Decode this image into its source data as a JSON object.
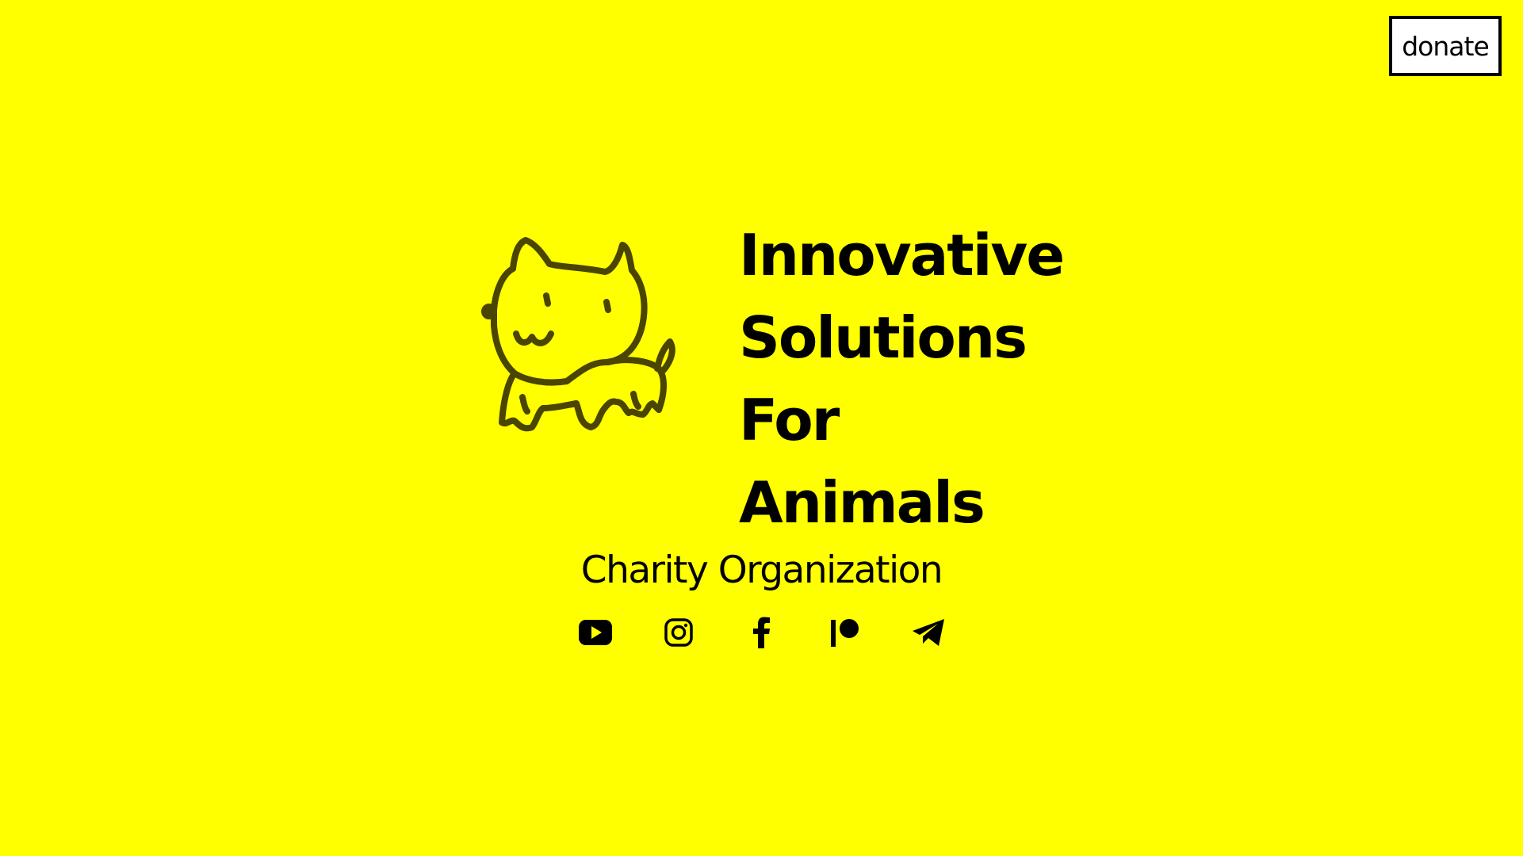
{
  "header": {
    "donate_label": "donate"
  },
  "hero": {
    "headline_lines": [
      "Innovative",
      "Solutions",
      "For",
      "Animals"
    ],
    "subtitle": "Charity Organization"
  },
  "socials": [
    {
      "name": "YouTube",
      "icon": "youtube-icon"
    },
    {
      "name": "Instagram",
      "icon": "instagram-icon"
    },
    {
      "name": "Facebook",
      "icon": "facebook-icon"
    },
    {
      "name": "Patreon",
      "icon": "patreon-icon"
    },
    {
      "name": "Telegram",
      "icon": "telegram-icon"
    }
  ],
  "colors": {
    "background": "#ffff00",
    "text": "#000000",
    "logo_stroke": "#4a4500",
    "button_bg": "#ffffff"
  }
}
